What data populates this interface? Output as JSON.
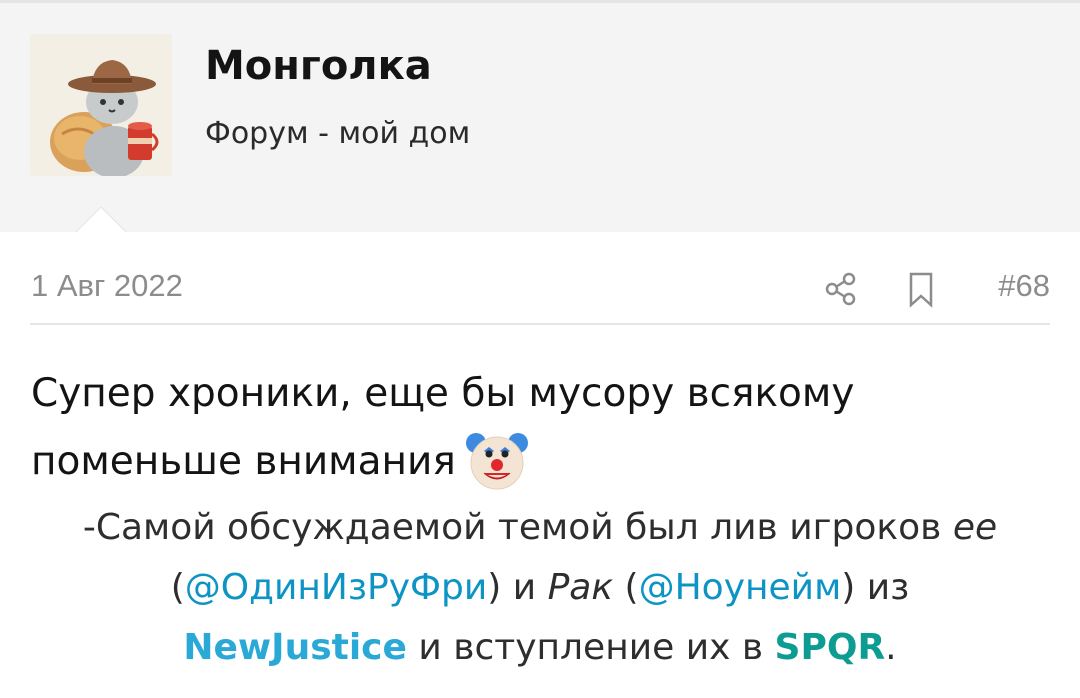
{
  "user": {
    "name": "Монголка",
    "title": "Форум - мой дом",
    "avatar_icon": "cat-with-hat-avatar-icon"
  },
  "post": {
    "date": "1 Авг 2022",
    "number": "#68",
    "share_icon": "share-icon",
    "bookmark_icon": "bookmark-icon",
    "text_line1": "Супер хроники, еще бы мусору всякому",
    "text_line2": "поменьше внимания",
    "emoji": "clown-face-icon"
  },
  "quote_image": {
    "line1_a": "-Самой обсуждаемой темой был лив игроков ",
    "line1_italic": "ее",
    "line2_open": "(",
    "line2_mention1": "@ОдинИзРуФри",
    "line2_mid": ") и ",
    "line2_italic": "Рак",
    "line2_open2": " (",
    "line2_mention2": "@Ноунейм",
    "line2_end": ") из",
    "line3_team1": "NewJustice",
    "line3_mid": " и вступление их в ",
    "line3_team2": "SPQR",
    "line3_end": "."
  },
  "colors": {
    "header_bg": "#f4f4f4",
    "muted_text": "#8c8c8c",
    "mention": "#0e94c4",
    "team_nj": "#2aa9d6",
    "team_spqr": "#0c9c92"
  }
}
